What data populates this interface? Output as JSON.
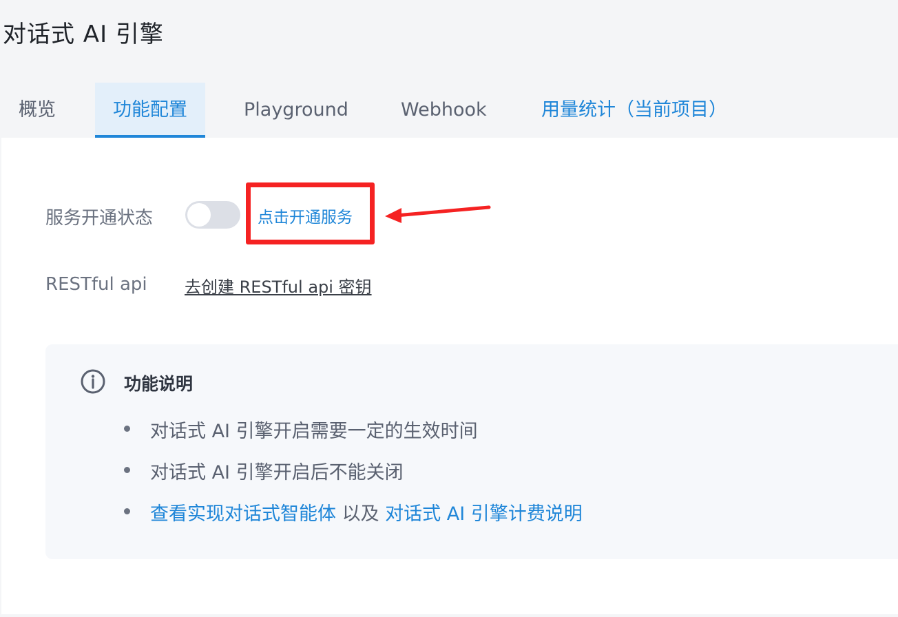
{
  "page": {
    "title": "对话式 AI 引擎"
  },
  "tabs": [
    {
      "label": "概览"
    },
    {
      "label": "功能配置"
    },
    {
      "label": "Playground"
    },
    {
      "label": "Webhook"
    },
    {
      "label": "用量统计（当前项目）"
    }
  ],
  "service": {
    "label": "服务开通状态",
    "toggle_on": false,
    "open_link": "点击开通服务"
  },
  "restful": {
    "label": "RESTful api",
    "link": "去创建 RESTful api 密钥"
  },
  "info": {
    "title": "功能说明",
    "items": [
      {
        "text": "对话式 AI 引擎开启需要一定的生效时间"
      },
      {
        "text": "对话式 AI 引擎开启后不能关闭"
      },
      {
        "link1": "查看实现对话式智能体",
        "middle": " 以及 ",
        "link2": "对话式 AI 引擎计费说明"
      }
    ]
  },
  "colors": {
    "accent": "#1f86d8",
    "highlight": "#f52222",
    "toggle_off": "#dcdfe6"
  }
}
